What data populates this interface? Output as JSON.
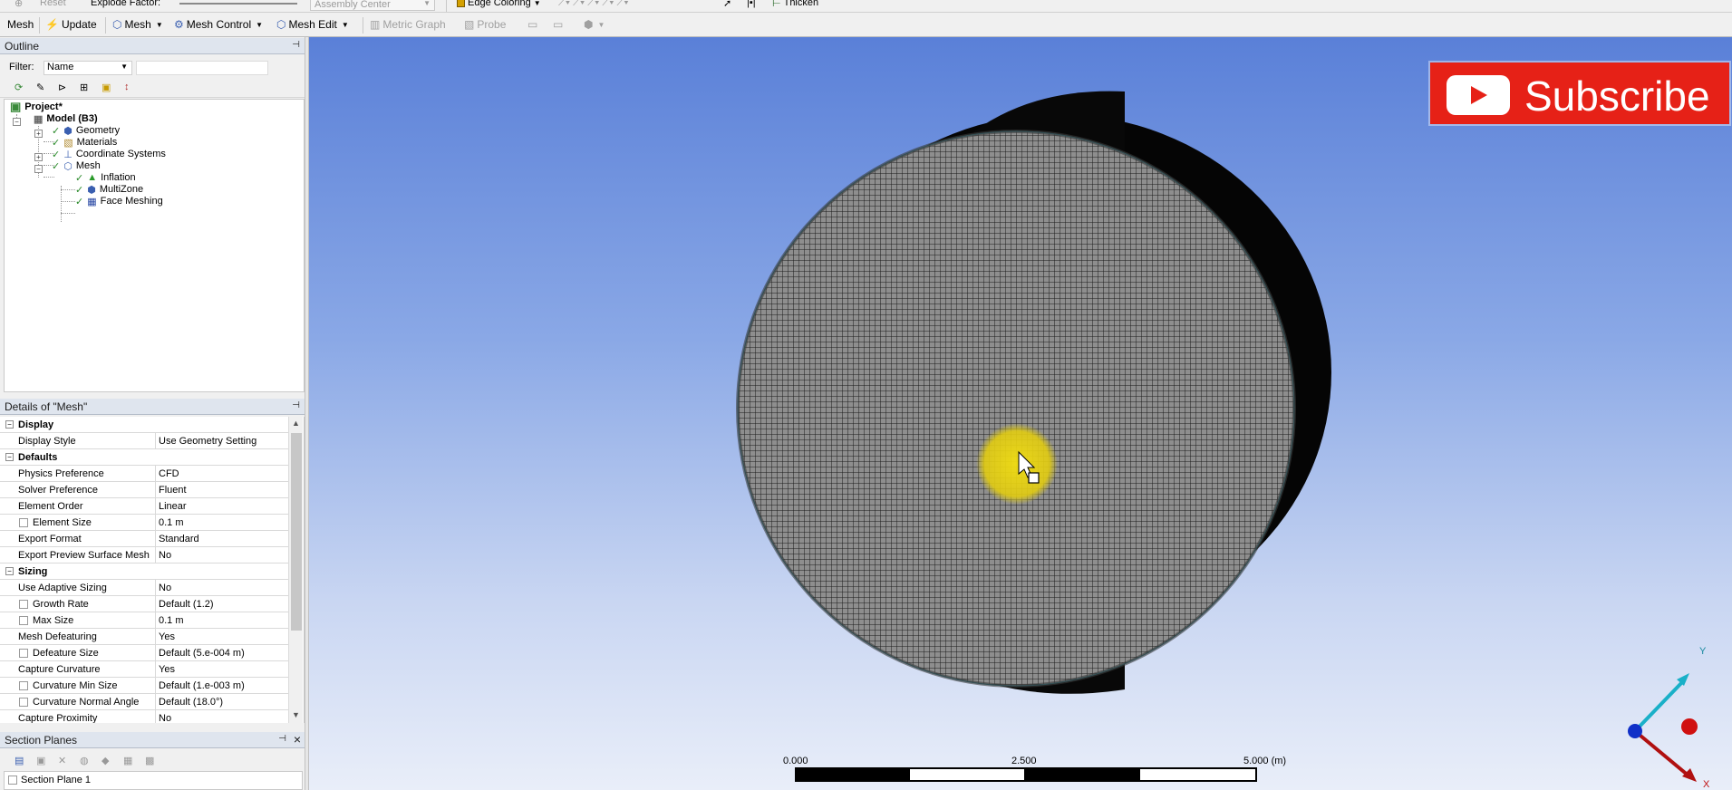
{
  "toolbar_top": {
    "reset": "Reset",
    "explode_factor": "Explode Factor:",
    "assembly_center": "Assembly Center",
    "edge_coloring": "Edge Coloring",
    "thicken": "Thicken"
  },
  "toolbar_mesh": {
    "mesh": "Mesh",
    "update": "Update",
    "mesh_menu": "Mesh",
    "mesh_control": "Mesh Control",
    "mesh_edit": "Mesh Edit",
    "metric_graph": "Metric Graph",
    "probe": "Probe"
  },
  "outline": {
    "title": "Outline",
    "filter_label": "Filter:",
    "filter_value": "Name",
    "tree": {
      "project": "Project*",
      "model": "Model (B3)",
      "geometry": "Geometry",
      "materials": "Materials",
      "coordinate_systems": "Coordinate Systems",
      "mesh": "Mesh",
      "inflation": "Inflation",
      "multizone": "MultiZone",
      "face_meshing": "Face Meshing"
    }
  },
  "details": {
    "title": "Details of \"Mesh\"",
    "rows": [
      {
        "kind": "group",
        "k": "Display"
      },
      {
        "kind": "row",
        "k": "Display Style",
        "v": "Use Geometry Setting"
      },
      {
        "kind": "group",
        "k": "Defaults"
      },
      {
        "kind": "row",
        "k": "Physics Preference",
        "v": "CFD"
      },
      {
        "kind": "row",
        "k": "Solver Preference",
        "v": "Fluent"
      },
      {
        "kind": "row",
        "k": "Element Order",
        "v": "Linear"
      },
      {
        "kind": "check",
        "k": "Element Size",
        "v": "0.1 m"
      },
      {
        "kind": "row",
        "k": "Export Format",
        "v": "Standard"
      },
      {
        "kind": "row",
        "k": "Export Preview Surface Mesh",
        "v": "No"
      },
      {
        "kind": "group",
        "k": "Sizing"
      },
      {
        "kind": "row",
        "k": "Use Adaptive Sizing",
        "v": "No"
      },
      {
        "kind": "check",
        "k": "Growth Rate",
        "v": "Default (1.2)"
      },
      {
        "kind": "check",
        "k": "Max Size",
        "v": "0.1 m"
      },
      {
        "kind": "row",
        "k": "Mesh Defeaturing",
        "v": "Yes"
      },
      {
        "kind": "check",
        "k": "Defeature Size",
        "v": "Default (5.e-004 m)"
      },
      {
        "kind": "row",
        "k": "Capture Curvature",
        "v": "Yes"
      },
      {
        "kind": "check",
        "k": "Curvature Min Size",
        "v": "Default (1.e-003 m)"
      },
      {
        "kind": "check",
        "k": "Curvature Normal Angle",
        "v": "Default (18.0°)"
      },
      {
        "kind": "row",
        "k": "Capture Proximity",
        "v": "No"
      }
    ]
  },
  "section_planes": {
    "title": "Section Planes",
    "item": "Section Plane 1"
  },
  "viewport": {
    "subscribe": "Subscribe",
    "scale": {
      "s0": "0.000",
      "s1": "2.500",
      "s2": "5.000 (m)"
    },
    "triad": {
      "y": "Y",
      "x": "X"
    }
  },
  "colors": {
    "subscribe_red": "#e62117",
    "bg_top": "#5a80d8",
    "bg_bottom": "#e9eef9",
    "highlight": "#e6d40a"
  }
}
